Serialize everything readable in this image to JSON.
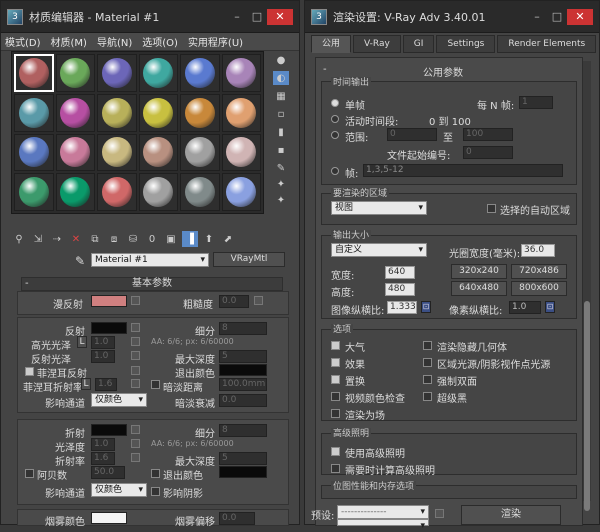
{
  "left_window": {
    "title": "材质编辑器 - Material #1",
    "menu": [
      "模式(D)",
      "材质(M)",
      "导航(N)",
      "选项(O)",
      "实用程序(U)"
    ],
    "material_colors": [
      "#b06060",
      "#6aa85a",
      "#6c66b8",
      "#3fa8a0",
      "#5a7ad0",
      "#a884b8",
      "#5a9aa8",
      "#b64fa2",
      "#b8b05a",
      "#c8c040",
      "#c8883a",
      "#e0a070",
      "#5a78c0",
      "#c87a9a",
      "#c8b880",
      "#b89080",
      "#a0a0a0",
      "#d0b4b4",
      "#3c9a6c",
      "#0a9a6a",
      "#d06868",
      "#a0a0a0",
      "#808a8a",
      "#8aa0e0"
    ],
    "material_name": "Material #1",
    "material_type": "VRayMtl",
    "rollout_title": "基本参数",
    "basic": {
      "diffuse": "漫反射",
      "roughness": "粗糙度",
      "roughness_val": "0.0",
      "reflect": "反射",
      "gloss_label": "细分",
      "gloss_val": "8",
      "hilight_gloss": "高光光泽",
      "hilight_L": "L",
      "hilight_val": "1.0",
      "refl_gloss": "反射光泽",
      "refl_gloss_val": "1.0",
      "aa_text": "AA: 6/6; px: 6/60000",
      "fresnel": "菲涅耳反射",
      "max_depth": "最大深度",
      "max_depth_val": "5",
      "exit_color": "退出颜色",
      "fresnel_ior": "菲涅耳折射率",
      "fresnel_L": "L",
      "fresnel_val": "1.6",
      "dim_dist": "暗淡距离",
      "dim_dist_val": "100.0mm",
      "affect_channels": "影响通道",
      "channel_opt": "仅颜色",
      "dim_falloff": "暗淡衰减",
      "dim_falloff_val": "0.0",
      "refract": "折射",
      "refr_subdiv": "细分",
      "refr_subdiv_val": "8",
      "refr_gloss": "光泽度",
      "refr_gloss_val": "1.0",
      "refr_aa": "AA: 6/6; px: 6/60000",
      "ior": "折射率",
      "ior_val": "1.6",
      "refr_max_depth": "最大深度",
      "refr_max_depth_val": "5",
      "abbe": "阿贝数",
      "abbe_val": "50.0",
      "refr_exit_color": "退出颜色",
      "affect_channels2": "影响通道",
      "channel_opt2": "仅颜色",
      "affect_shadows": "影响阴影",
      "fog_color": "烟雾颜色",
      "fog_bias": "烟雾偏移",
      "fog_bias_val": "0.0"
    }
  },
  "right_window": {
    "title": "渲染设置: V-Ray Adv 3.40.01",
    "tabs": [
      "公用",
      "V-Ray",
      "GI",
      "Settings",
      "Render Elements"
    ],
    "rollout": "公用参数",
    "time_output": "时间输出",
    "single": "单帧",
    "every_n": "每 N 帧:",
    "every_n_val": "1",
    "active_segment": "活动时间段:",
    "active_range": "0 到 100",
    "range": "范围:",
    "range_from": "0",
    "range_to_word": "至",
    "range_to": "100",
    "file_start": "文件起始编号:",
    "file_start_val": "0",
    "frames": "帧:",
    "frames_val": "1,3,5-12",
    "area_title": "要渲染的区域",
    "area_opt": "视图",
    "auto_region": "选择的自动区域",
    "output_size": "输出大小",
    "size_preset": "自定义",
    "aperture": "光圈宽度(毫米):",
    "aperture_val": "36.0",
    "width": "宽度:",
    "width_val": "640",
    "height": "高度:",
    "height_val": "480",
    "presets": [
      "320x240",
      "720x486",
      "640x480",
      "800x600"
    ],
    "img_aspect": "图像纵横比:",
    "img_aspect_val": "1.333",
    "px_aspect": "像素纵横比:",
    "px_aspect_val": "1.0",
    "options": "选项",
    "atmos": "大气",
    "effects": "效果",
    "displace": "置换",
    "video_check": "视频颜色检查",
    "render_hidden_geo": "渲染隐藏几何体",
    "area_lights": "区域光源/阴影视作点光源",
    "force_2side": "强制双面",
    "super_black": "超级黑",
    "render_fields": "渲染为场",
    "adv_light": "高级照明",
    "use_adv": "使用高级照明",
    "compute_adv": "需要时计算高级照明",
    "bitmap_perf": "位图性能和内存选项",
    "preset": "预设:",
    "render_btn": "渲染"
  }
}
